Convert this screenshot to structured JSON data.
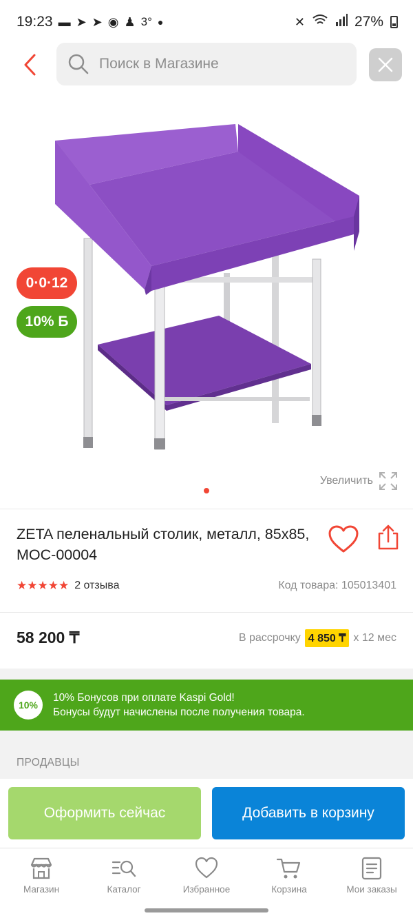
{
  "status_bar": {
    "time": "19:23",
    "temperature": "3°",
    "battery": "27%",
    "left_icons": [
      "message-icon",
      "telegram-icon",
      "telegram-icon",
      "chrome-icon",
      "game-icon"
    ],
    "right_icons": [
      "mute-icon",
      "wifi-icon",
      "signal-icon",
      "battery-icon"
    ]
  },
  "search": {
    "placeholder": "Поиск в Магазине"
  },
  "gallery": {
    "badge_installment": "0·0·12",
    "badge_bonus": "10% Б",
    "zoom_label": "Увеличить",
    "image_count": 1,
    "active_image": 1
  },
  "product": {
    "title": "ZETA пеленальный столик, металл, 85x85, МОС-00004",
    "rating_stars": 5,
    "reviews": "2 отзыва",
    "code": "Код товара: 105013401",
    "price": "58 200 ₸",
    "installment_prefix": "В рассрочку",
    "installment_amount": "4 850 ₸",
    "installment_suffix": "x 12 мес"
  },
  "bonus": {
    "badge": "10%",
    "line1": "10% Бонусов при оплате Kaspi Gold!",
    "line2": "Бонусы будут начислены после получения товара."
  },
  "sellers": {
    "title": "ПРОДАВЦЫ"
  },
  "actions": {
    "buy_now": "Оформить сейчас",
    "add_to_cart": "Добавить в корзину"
  },
  "tabs": [
    {
      "label": "Магазин",
      "icon": "store-icon"
    },
    {
      "label": "Каталог",
      "icon": "catalog-icon"
    },
    {
      "label": "Избранное",
      "icon": "heart-icon"
    },
    {
      "label": "Корзина",
      "icon": "cart-icon"
    },
    {
      "label": "Мои заказы",
      "icon": "orders-icon"
    }
  ],
  "colors": {
    "accent_red": "#f14635",
    "bonus_green": "#4ea61b",
    "buy_green": "#a5d86d",
    "cart_blue": "#0a84d8",
    "installment_yellow": "#ffd400"
  }
}
